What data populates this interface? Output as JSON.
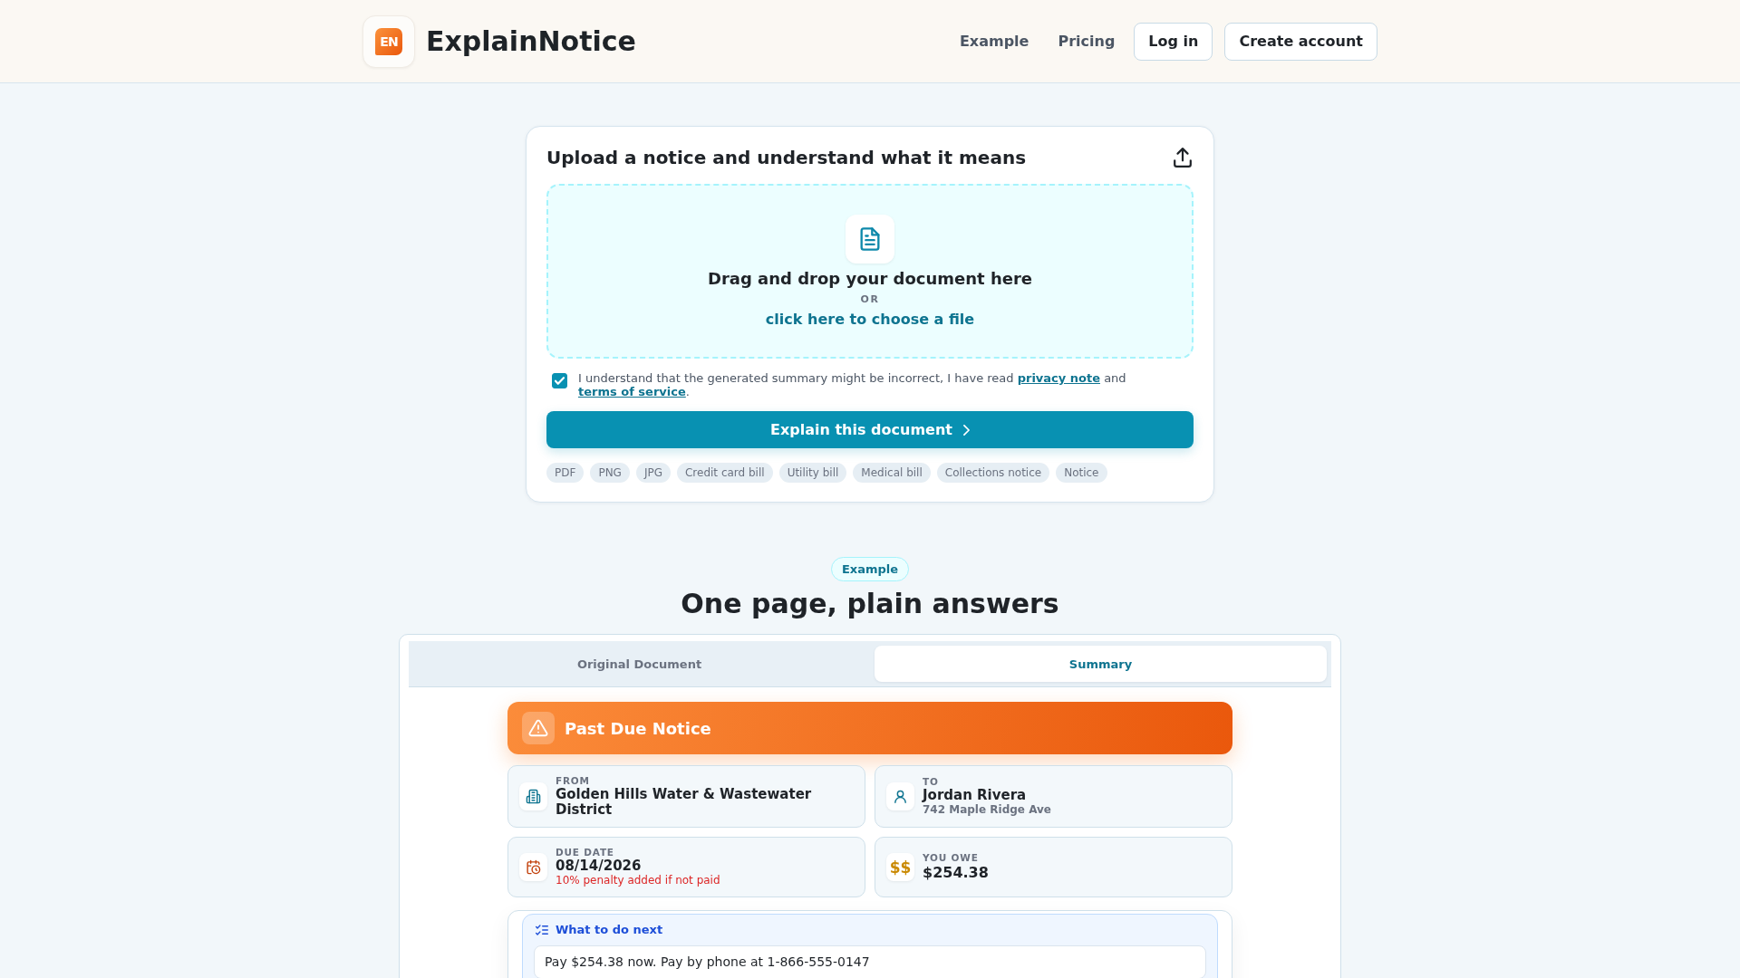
{
  "header": {
    "logo_text": "EN",
    "brand": "ExplainNotice",
    "nav_links": [
      "Example",
      "Pricing"
    ],
    "buttons": [
      "Log in",
      "Create account"
    ]
  },
  "upload": {
    "title": "Upload a notice and understand what it means",
    "dropzone": {
      "heading": "Drag and drop your document here",
      "separator": "OR",
      "link": "click here to choose a file"
    },
    "consent": {
      "checked": true,
      "segments": [
        {
          "kind": "text",
          "text": "I understand that the generated summary might be incorrect, I have read "
        },
        {
          "kind": "link",
          "text": "privacy note"
        },
        {
          "kind": "text",
          "text": " and "
        },
        {
          "kind": "link",
          "text": "terms of service"
        },
        {
          "kind": "text",
          "text": "."
        }
      ]
    },
    "submit_button": "Explain this document",
    "tags": [
      "PDF",
      "PNG",
      "JPG",
      "Credit card bill",
      "Utility bill",
      "Medical bill",
      "Collections notice",
      "Notice"
    ]
  },
  "example": {
    "badge": "Example",
    "heading": "One page, plain answers",
    "tabs": [
      {
        "label": "Original Document",
        "selected": false
      },
      {
        "label": "Summary",
        "selected": true
      }
    ],
    "summary": {
      "banner": "Past Due Notice",
      "from": {
        "label": "FROM",
        "value": "Golden Hills Water & Wastewater District"
      },
      "to": {
        "label": "TO",
        "value": "Jordan Rivera",
        "detail": "742 Maple Ridge Ave"
      },
      "due_date": {
        "label": "DUE DATE",
        "value": "08/14/2026",
        "note": "10% penalty added if not paid"
      },
      "amount_owed": {
        "label": "YOU OWE",
        "symbol": "$$",
        "value": "$254.38"
      },
      "next_steps": {
        "title": "What to do next",
        "items": [
          "Pay $254.38 now. Pay by phone at 1-866-555-0147"
        ]
      }
    }
  }
}
